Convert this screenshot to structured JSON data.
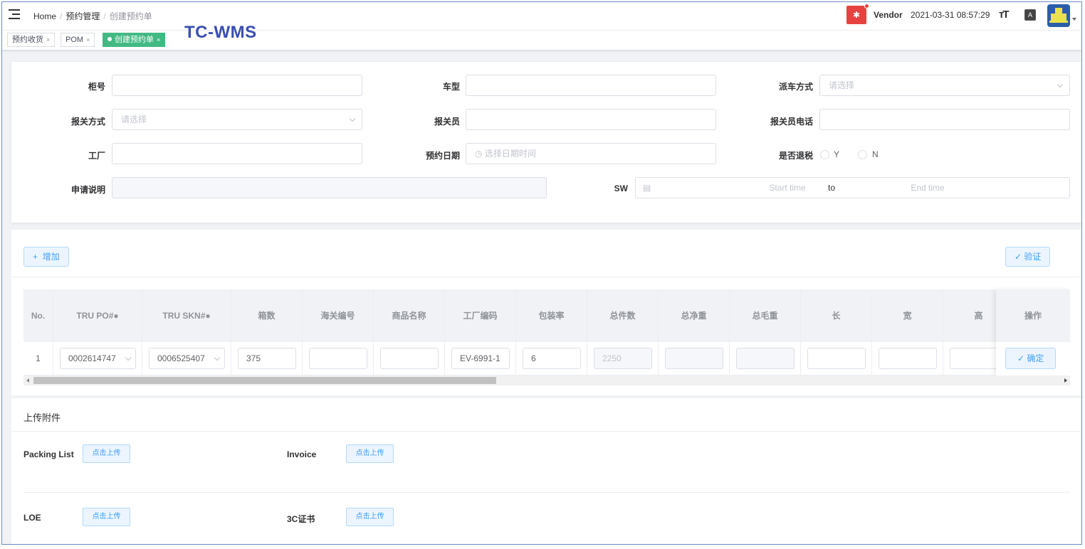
{
  "header": {
    "breadcrumb": [
      "Home",
      "预约管理",
      "创建预约单"
    ],
    "separator": "/",
    "bug_icon": "bug-icon",
    "user": "Vendor",
    "datetime": "2021-03-31 08:57:29",
    "size_icon_text": "тT",
    "lang_icon_text": "A",
    "caret": ""
  },
  "tags": [
    {
      "label": "预约收货",
      "close": "×"
    },
    {
      "label": "POM",
      "close": "×"
    },
    {
      "label": "创建预约单",
      "close": "×"
    }
  ],
  "brand": "TC-WMS",
  "form": {
    "cabinet_no": {
      "label": "柜号",
      "value": ""
    },
    "vehicle_type": {
      "label": "车型",
      "value": ""
    },
    "dispatch": {
      "label": "派车方式",
      "placeholder": "请选择"
    },
    "customs_method": {
      "label": "报关方式",
      "placeholder": "请选择"
    },
    "customs_officer": {
      "label": "报关员",
      "value": ""
    },
    "customs_phone": {
      "label": "报关员电话",
      "value": ""
    },
    "factory": {
      "label": "工厂",
      "value": ""
    },
    "appt_date": {
      "label": "预约日期",
      "placeholder": "选择日期时间"
    },
    "tax_refund": {
      "label": "是否退税",
      "options": [
        "Y",
        "N"
      ]
    },
    "application_note": {
      "label": "申请说明",
      "value": ""
    },
    "sw": {
      "label": "SW",
      "start_placeholder": "Start time",
      "to": "to",
      "end_placeholder": "End time"
    }
  },
  "toolbar": {
    "add_label": "增加",
    "add_icon": "+",
    "verify_label": "验证",
    "verify_icon": "✓"
  },
  "table": {
    "headers": [
      "No.",
      "TRU PO#",
      "TRU SKN#",
      "箱数",
      "海关编号",
      "商品名称",
      "工厂编码",
      "包装率",
      "总件数",
      "总净重",
      "总毛重",
      "长",
      "宽",
      "高"
    ],
    "info_icon": "info-circle-icon",
    "action_header": "操作",
    "rows": [
      {
        "no": "1",
        "po": "0002614747",
        "skn": "0006525407",
        "boxes": "375",
        "customs_no": "",
        "product_name": "",
        "factory_code": "EV-6991-1",
        "pack_rate": "6",
        "total_qty": "2250",
        "net_weight": "",
        "gross_weight": "",
        "length": "",
        "width": "",
        "height": "",
        "action": "确定"
      }
    ]
  },
  "upload": {
    "title": "上传附件",
    "button_label": "点击上传",
    "items": [
      "Packing List",
      "Invoice",
      "LOE",
      "3C证书"
    ]
  }
}
